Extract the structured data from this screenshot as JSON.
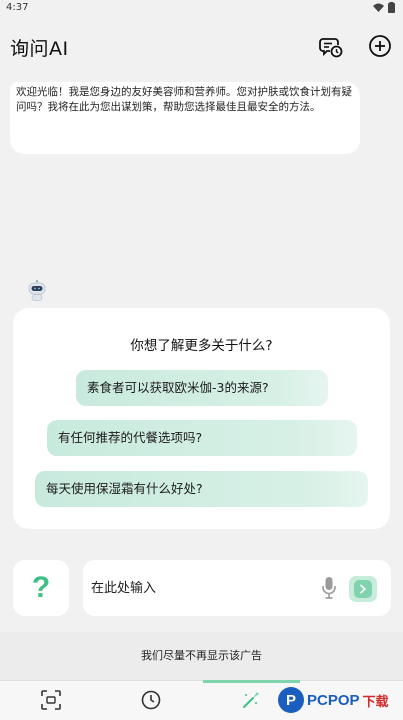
{
  "status_bar": {
    "time": "4:37"
  },
  "header": {
    "title": "询问AI",
    "history_icon": "chat-history-icon",
    "add_icon": "plus-circle-icon"
  },
  "welcome_message": "欢迎光临！我是您身边的友好美容师和营养师。您对护肤或饮食计划有疑问吗？我将在此为您出谋划策，帮助您选择最佳且最安全的方法。",
  "suggestions": {
    "title": "你想了解更多关于什么?",
    "items": [
      {
        "label": "素食者可以获取欧米伽-3的来源?"
      },
      {
        "label": "有任何推荐的代餐选项吗?"
      },
      {
        "label": "每天使用保湿霜有什么好处?"
      }
    ]
  },
  "input": {
    "help_symbol": "?",
    "placeholder": "在此处输入",
    "mic_icon": "microphone-icon",
    "send_icon": "send-arrow-icon"
  },
  "ad_banner": "我们尽量不再显示该广告",
  "bottom_nav": {
    "items": [
      {
        "icon": "scan-icon"
      },
      {
        "icon": "clock-icon"
      },
      {
        "icon": "brush-icon",
        "active": true
      }
    ]
  },
  "watermark": {
    "logo_letter": "P",
    "text": "PCPOP",
    "text2": "下载"
  },
  "colors": {
    "accent": "#3fbf86",
    "chip_bg": "#c8eadd",
    "send_bg": "#7fd3ad",
    "background": "#f1f1f1"
  }
}
